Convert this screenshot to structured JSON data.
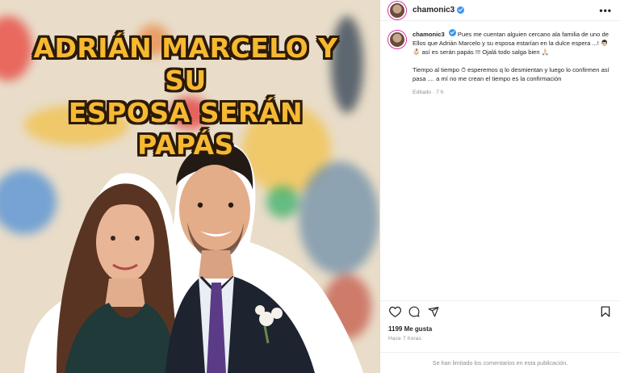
{
  "post": {
    "headline_line1": "ADRIÁN MARCELO Y SU",
    "headline_line2": "ESPOSA SERÁN PAPÁS"
  },
  "header": {
    "username": "chamonic3",
    "more_label": "•••"
  },
  "caption": {
    "username": "chamonic3",
    "para1": "Pues me cuentan alguien cercano ala familia de uno de Ellos que Adrián Marcelo y su esposa estarían en la dulce espera ...! 👨🏻 👶🏻 así es serán papás !!! Ojalá todo salga bien 🙏🏻",
    "para2": "Tiempo al tiempo ⏱ esperemos q lo desmientan y luego lo confirmen así pasa .... a mí no me crean el tiempo es la confirmación",
    "edited": "Editado · 7 h"
  },
  "actions": {
    "icons": [
      "heart-icon",
      "comment-icon",
      "share-icon",
      "bookmark-icon"
    ]
  },
  "likes": "1199 Me gusta",
  "posted_ago": "Hace 7 horas",
  "comments_limited": "Se han limitado los comentarios en esta publicación.",
  "colors": {
    "headline_fill": "#f7b832",
    "headline_outline": "#2a1a08",
    "verified": "#3897f0",
    "muted_text": "#8e8e8e"
  }
}
